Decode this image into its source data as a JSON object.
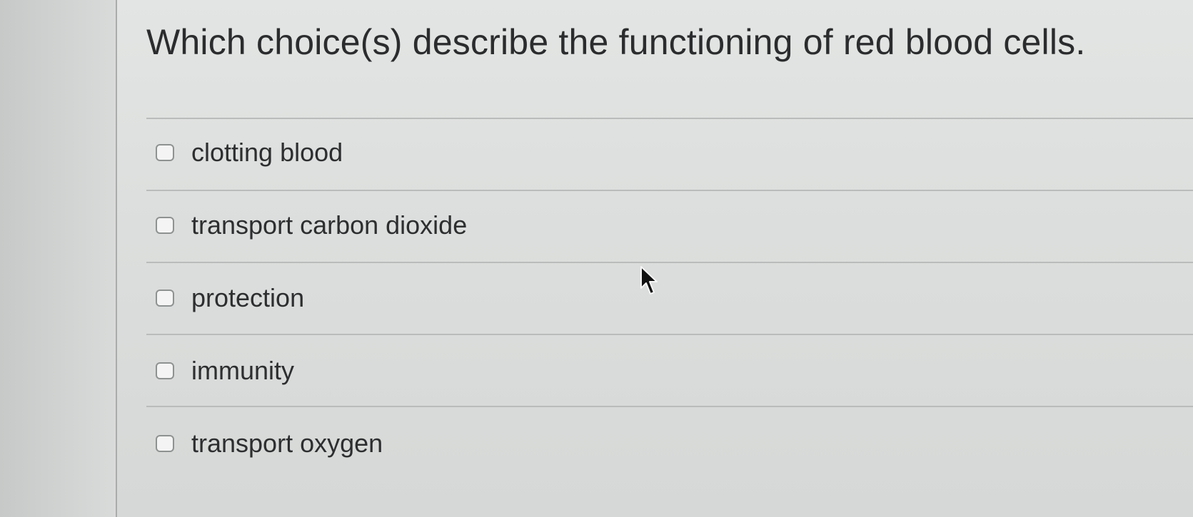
{
  "question": {
    "title": "Which choice(s) describe the functioning of red blood cells."
  },
  "options": [
    {
      "label": "clotting blood",
      "checked": false
    },
    {
      "label": "transport carbon dioxide",
      "checked": false
    },
    {
      "label": "protection",
      "checked": false
    },
    {
      "label": "immunity",
      "checked": false
    },
    {
      "label": "transport oxygen",
      "checked": false
    }
  ],
  "icons": {
    "cursor": "mouse-pointer-icon",
    "checkbox": "checkbox-unchecked-icon"
  },
  "colors": {
    "text": "#2a2c2d",
    "panel_background": "#dfe1e0",
    "divider": "#b9bcbb",
    "checkbox_border": "#8e9291"
  }
}
